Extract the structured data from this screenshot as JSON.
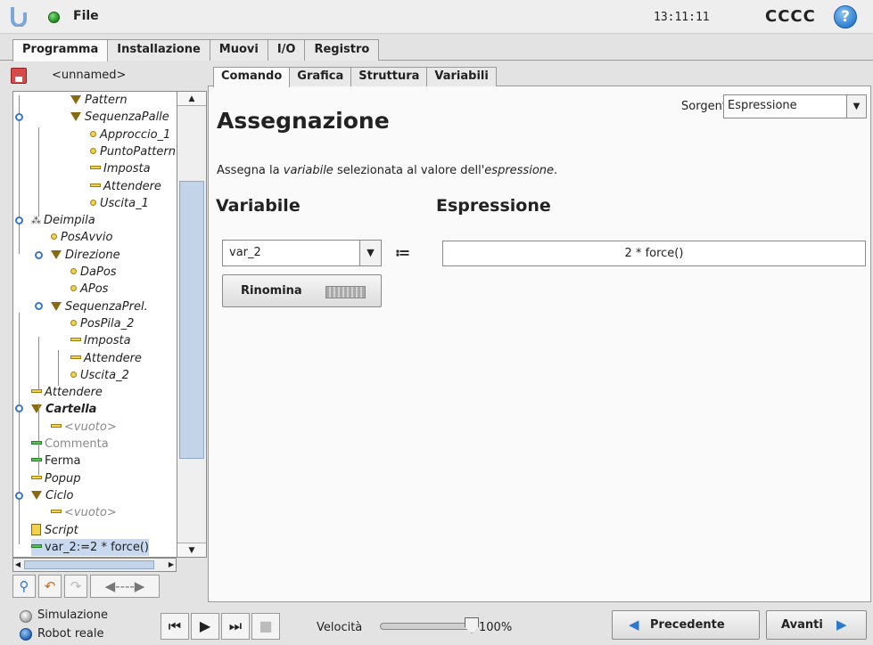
{
  "topbar": {
    "file_label": "File",
    "clock": "13:11:11",
    "robot_name": "CCCC",
    "help_glyph": "?"
  },
  "main_tabs": [
    {
      "label": "Programma",
      "active": true
    },
    {
      "label": "Installazione",
      "active": false
    },
    {
      "label": "Muovi",
      "active": false
    },
    {
      "label": "I/O",
      "active": false
    },
    {
      "label": "Registro",
      "active": false
    }
  ],
  "program": {
    "name": "<unnamed>",
    "tree": [
      {
        "label": "Pattern",
        "icon": "triangle"
      },
      {
        "label": "SequenzaPalle",
        "icon": "triangle"
      },
      {
        "label": "Approccio_1",
        "icon": "waypoint"
      },
      {
        "label": "PuntoPattern",
        "icon": "waypoint"
      },
      {
        "label": "Imposta",
        "icon": "bar"
      },
      {
        "label": "Attendere",
        "icon": "bar"
      },
      {
        "label": "Uscita_1",
        "icon": "waypoint"
      },
      {
        "label": "Deimpila",
        "icon": "pallet"
      },
      {
        "label": "PosAvvio",
        "icon": "waypoint"
      },
      {
        "label": "Direzione",
        "icon": "triangle"
      },
      {
        "label": "DaPos",
        "icon": "waypoint"
      },
      {
        "label": "APos",
        "icon": "waypoint"
      },
      {
        "label": "SequenzaPrel.",
        "icon": "triangle"
      },
      {
        "label": "PosPila_2",
        "icon": "waypoint"
      },
      {
        "label": "Imposta",
        "icon": "bar"
      },
      {
        "label": "Attendere",
        "icon": "bar"
      },
      {
        "label": "Uscita_2",
        "icon": "waypoint"
      },
      {
        "label": "Attendere",
        "icon": "bar"
      },
      {
        "label": "Cartella",
        "icon": "triangle"
      },
      {
        "label": "<vuoto>",
        "icon": "bar"
      },
      {
        "label": "Commenta",
        "icon": "bar-green"
      },
      {
        "label": "Ferma",
        "icon": "bar-green"
      },
      {
        "label": "Popup",
        "icon": "bar"
      },
      {
        "label": "Ciclo",
        "icon": "triangle"
      },
      {
        "label": "<vuoto>",
        "icon": "bar"
      },
      {
        "label": "Script",
        "icon": "script"
      },
      {
        "label": "var_2:=2 * force()",
        "icon": "bar-green",
        "selected": true
      }
    ]
  },
  "sub_tabs": [
    {
      "label": "Comando",
      "active": true
    },
    {
      "label": "Grafica",
      "active": false
    },
    {
      "label": "Struttura",
      "active": false
    },
    {
      "label": "Variabili",
      "active": false
    }
  ],
  "command": {
    "source_label": "Sorgente",
    "source_value": "Espressione",
    "title": "Assegnazione",
    "desc_1": "Assegna la ",
    "desc_2": "variabile",
    "desc_3": " selezionata al valore dell'",
    "desc_4": "espressione",
    "desc_5": ".",
    "variable_header": "Variabile",
    "expression_header": "Espressione",
    "variable_value": "var_2",
    "assign_operator": "≔",
    "expression_value": "2 * force()",
    "rename_label": "Rinomina"
  },
  "bottom": {
    "simulation_label": "Simulazione",
    "real_robot_label": "Robot reale",
    "speed_label": "Velocità",
    "speed_value": "100%",
    "speed_fraction": 1.0,
    "prev_label": "Precedente",
    "next_label": "Avanti"
  }
}
